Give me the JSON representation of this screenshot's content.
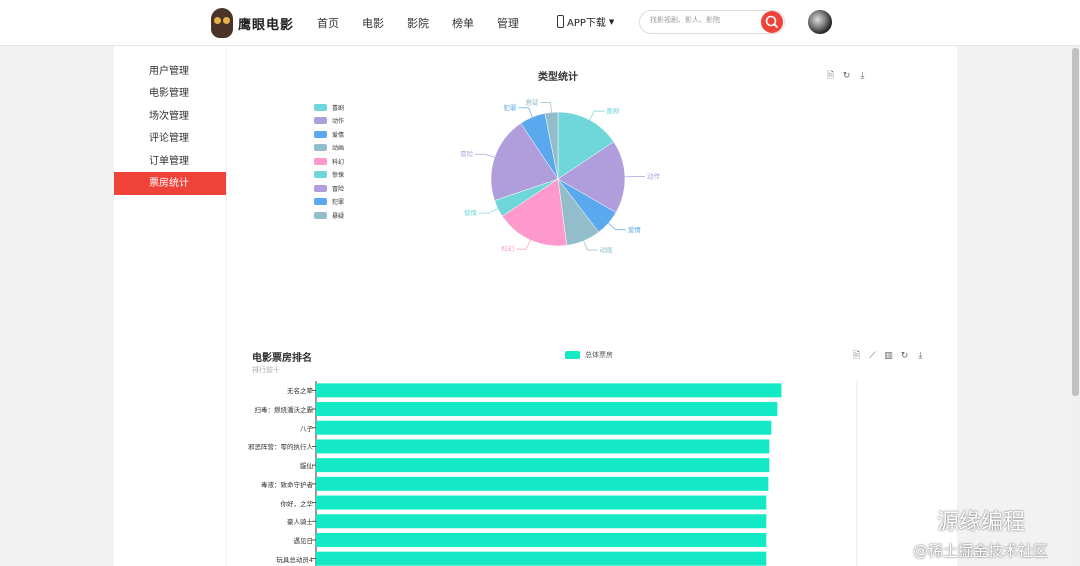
{
  "header": {
    "logo_text": "鹰眼电影",
    "nav": [
      "首页",
      "电影",
      "影院",
      "榜单",
      "管理"
    ],
    "app_download": "APP下载",
    "search_placeholder": "找影视剧、影人、影院"
  },
  "sidebar": {
    "items": [
      "用户管理",
      "电影管理",
      "场次管理",
      "评论管理",
      "订单管理",
      "票房统计"
    ],
    "active_index": 5
  },
  "colors": {
    "accent": "#ef4238",
    "bar": "#13eac5"
  },
  "chart_data": [
    {
      "type": "pie",
      "title": "类型统计",
      "legend_position": "left",
      "categories": [
        "喜剧",
        "动作",
        "爱情",
        "动画",
        "科幻",
        "惊悚",
        "冒险",
        "犯罪",
        "悬疑"
      ],
      "values": [
        15,
        17,
        6,
        8,
        17,
        4,
        20,
        6,
        3
      ],
      "colors": [
        "#6fd6d9",
        "#b09ddc",
        "#5aa9ee",
        "#94bdcb",
        "#fe99cd",
        "#6fd6d9",
        "#b09ddc",
        "#5aa9ee",
        "#94bdcb"
      ]
    },
    {
      "type": "bar",
      "orientation": "horizontal",
      "title": "电影票房排名",
      "subtitle": "排行前十",
      "series": [
        {
          "name": "总体票房",
          "values": [
            46.2,
            45.8,
            45.2,
            45.0,
            45.0,
            44.9,
            44.7,
            44.7,
            44.7,
            44.7
          ]
        }
      ],
      "categories": [
        "无名之辈",
        "扫毒：燃烧潘沃之霸",
        "八子",
        "邪恶阵营：零的执行人",
        "龌仙",
        "毒液：致命守护者",
        "你好，之华",
        "豪人骑士",
        "遇见日",
        "玩具总动员4"
      ],
      "xlim": [
        0,
        53.7
      ]
    }
  ],
  "watermark": {
    "line1": "源缘编程",
    "line2": "@稀土掘金技术社区"
  }
}
